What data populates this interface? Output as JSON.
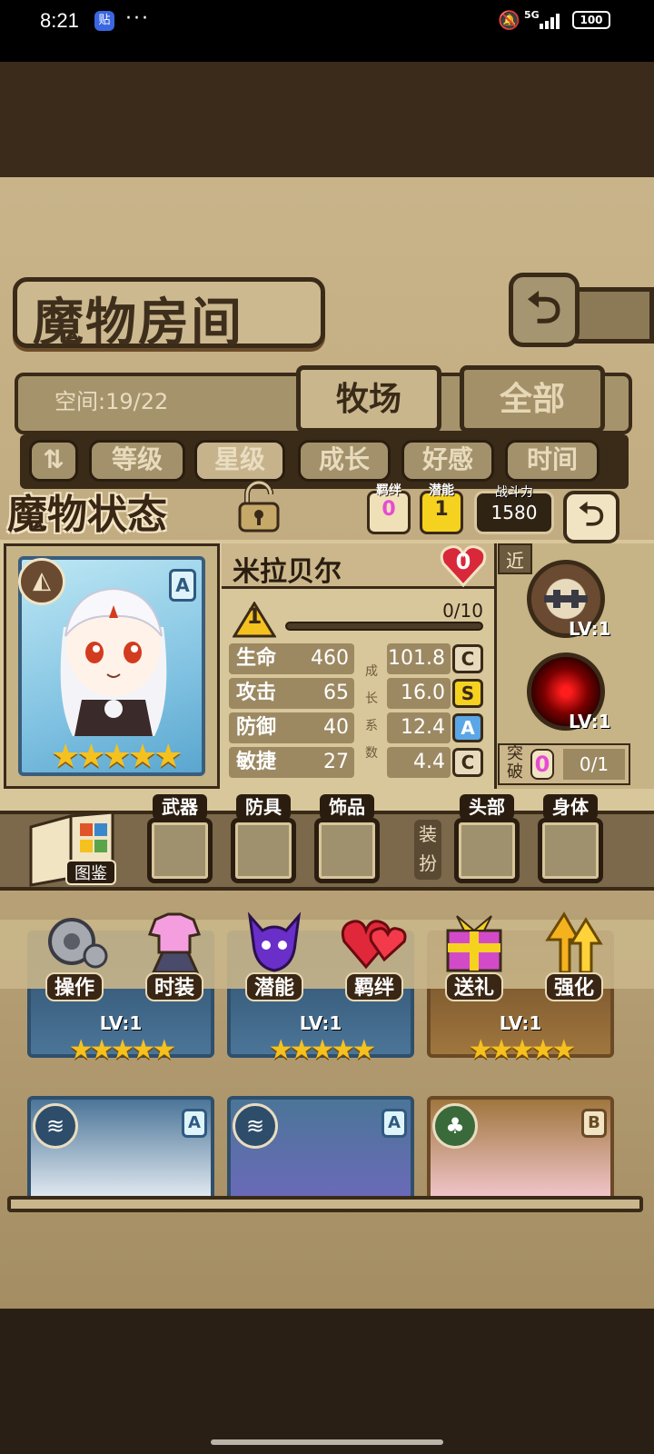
{
  "status_bar": {
    "time": "8:21",
    "app_icon": "贴",
    "network": "5G",
    "battery": "100"
  },
  "header": {
    "title": "魔物房间",
    "space_label": "空间:19/22",
    "tabs": [
      {
        "label": "牧场"
      },
      {
        "label": "全部"
      }
    ]
  },
  "sort": {
    "options": [
      "等级",
      "星级",
      "成长",
      "好感",
      "时间"
    ],
    "active": "星级"
  },
  "status_panel": {
    "title": "魔物状态",
    "bond": {
      "label": "羁绊",
      "value": "0"
    },
    "potential": {
      "label": "潜能",
      "value": "1"
    },
    "power": {
      "label": "战斗力",
      "value": "1580"
    },
    "name": "米拉贝尔",
    "favor": "0",
    "level": "1",
    "exp": "0/10",
    "exp_fraction": 0,
    "rank": "A",
    "stars": "★★★★★",
    "stats": [
      {
        "label": "生命",
        "value": "460",
        "growth": "101.8",
        "grade": "C"
      },
      {
        "label": "攻击",
        "value": "65",
        "growth": "16.0",
        "grade": "S"
      },
      {
        "label": "防御",
        "value": "40",
        "growth": "12.4",
        "grade": "A"
      },
      {
        "label": "敏捷",
        "value": "27",
        "growth": "4.4",
        "grade": "C"
      }
    ],
    "growth_vertical": [
      "成",
      "长",
      "系",
      "数"
    ],
    "attack_type": "近",
    "skills": [
      {
        "lv": "LV:1"
      },
      {
        "lv": "LV:1"
      }
    ],
    "breakthrough": {
      "label": "突破",
      "value": "0",
      "fraction": "0/1"
    }
  },
  "equipment": {
    "guidebook": "图鉴",
    "slots": [
      "武器",
      "防具",
      "饰品",
      "头部",
      "身体"
    ],
    "dress_label": "装扮"
  },
  "actions": [
    "操作",
    "时装",
    "潜能",
    "羁绊",
    "送礼",
    "强化"
  ],
  "grid": {
    "row1": [
      {
        "lv": "LV:1",
        "stars": "★★★★★"
      },
      {
        "lv": "LV:1",
        "stars": "★★★★★"
      },
      {
        "lv": "LV:1",
        "stars": "★★★★★"
      }
    ],
    "row2": [
      {
        "rank": "A"
      },
      {
        "rank": "A"
      },
      {
        "rank": "B"
      }
    ]
  },
  "colors": {
    "grade_C": "#e8dbbd",
    "grade_S": "#f5d21f",
    "grade_A": "#5aa6e6",
    "pink": "#e64bd2"
  }
}
